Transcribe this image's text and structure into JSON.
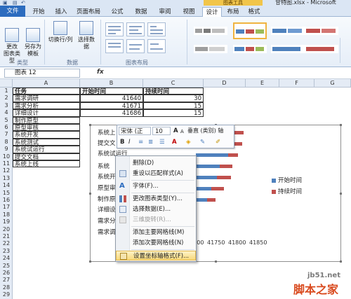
{
  "window": {
    "filename": "甘特图.xlsx - Microsoft Excel",
    "context_tool": "图表工具"
  },
  "tabs": [
    {
      "label": "文件"
    },
    {
      "label": "开始"
    },
    {
      "label": "插入"
    },
    {
      "label": "页面布局"
    },
    {
      "label": "公式"
    },
    {
      "label": "数据"
    },
    {
      "label": "审阅"
    },
    {
      "label": "视图"
    },
    {
      "label": "设计"
    },
    {
      "label": "布局"
    },
    {
      "label": "格式"
    }
  ],
  "ribbon": {
    "change_chart_type": "更改\n图表类型",
    "save_as_template": "另存为\n模板",
    "switch_row_col": "切换行/列",
    "select_data": "选择数据",
    "group_type": "类型",
    "group_data": "数据",
    "group_layout": "图表布局"
  },
  "formula_bar": {
    "name_box": "图表 12",
    "fx": "fx"
  },
  "columns": [
    "A",
    "B",
    "C",
    "D",
    "E",
    "F",
    "G"
  ],
  "rows": [
    "1",
    "2",
    "3",
    "4",
    "5",
    "6",
    "7",
    "8",
    "9",
    "10",
    "11",
    "12",
    "13",
    "14",
    "15",
    "16",
    "17",
    "18",
    "19",
    "20",
    "21",
    "22",
    "23",
    "24",
    "25",
    "26",
    "27",
    "28",
    "29"
  ],
  "sheet": {
    "headers": [
      "任务",
      "开始时间",
      "持续时间"
    ],
    "tasks": [
      "需求调研",
      "需求分析",
      "详细设计",
      "制作原型",
      "原型审核",
      "系统开发",
      "系统测试",
      "系统试运行",
      "提交文档",
      "系统上线"
    ],
    "start": [
      "41640",
      "41671",
      "41686"
    ],
    "duration": [
      "30",
      "15",
      "15"
    ]
  },
  "chart": {
    "y_labels": [
      "系统上",
      "提交文",
      "系统试运行",
      "系统",
      "系统开",
      "原型审",
      "制作原",
      "详细设",
      "需求分",
      "需求调"
    ],
    "x_ticks": [
      "41700",
      "41750",
      "41800",
      "41850"
    ],
    "legend": [
      "开始时间",
      "持续时间"
    ]
  },
  "mini_toolbar": {
    "font_name": "宋体 (正",
    "font_size": "10",
    "grow": "A",
    "shrink": "A",
    "target": "垂直 (类别) 轴",
    "bold": "B",
    "italic": "I"
  },
  "context_menu": [
    {
      "label": "删除(D)"
    },
    {
      "label": "重设以匹配样式(A)"
    },
    {
      "label": "字体(F)..."
    },
    {
      "label": "更改图表类型(Y)..."
    },
    {
      "label": "选择数据(E)..."
    },
    {
      "label": "三维旋转(R)..."
    },
    {
      "label": "添加主要网格线(M)"
    },
    {
      "label": "添加次要网格线(N)"
    },
    {
      "label": "设置坐标轴格式(F)..."
    }
  ],
  "watermark": {
    "url": "jb51.net",
    "cn": "脚本之家"
  },
  "colors": {
    "series_start": "#4f81bd",
    "series_duration": "#c0504d",
    "file_tab": "#2c6cbf",
    "context_tool": "#f1c54a"
  }
}
